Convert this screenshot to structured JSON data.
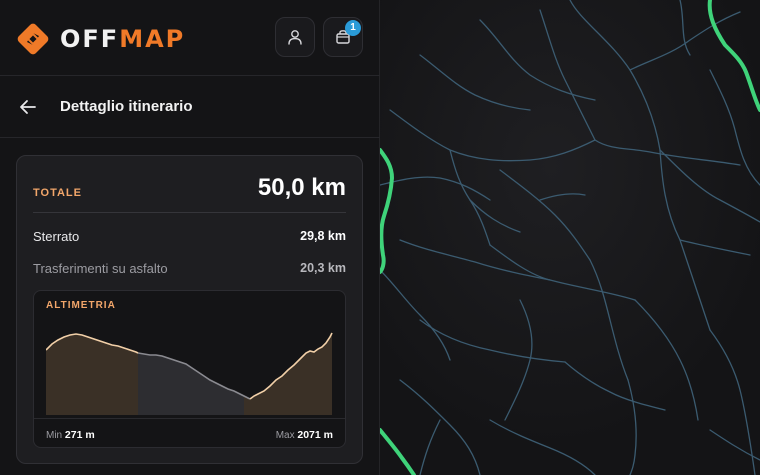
{
  "header": {
    "brand_part1": "OFF",
    "brand_part2": "MAP",
    "cart_badge": "1",
    "accent_color": "#f07a28"
  },
  "subheader": {
    "title": "Dettaglio itinerario"
  },
  "summary": {
    "total_label": "TOTALE",
    "total_value": "50,0 km",
    "rows": [
      {
        "label": "Sterrato",
        "value": "29,8 km"
      },
      {
        "label": "Trasferimenti su asfalto",
        "value": "20,3 km"
      }
    ]
  },
  "elevation": {
    "title": "ALTIMETRIA",
    "min_label": "Min",
    "min_value": "271 m",
    "max_label": "Max",
    "max_value": "2071 m"
  },
  "map": {
    "route_color": "#3fd37a",
    "stream_color": "#3b5b70"
  }
}
